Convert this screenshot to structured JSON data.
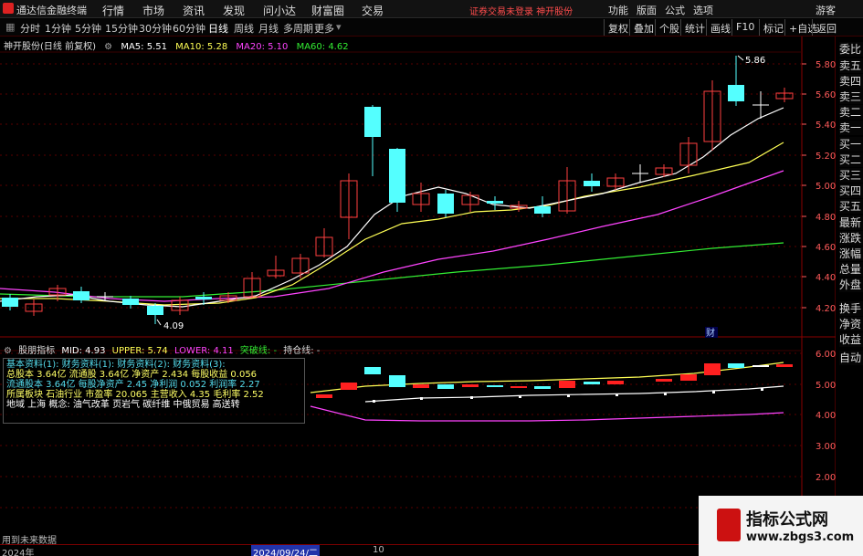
{
  "app": {
    "title": "通达信金融终端",
    "menu": [
      "行情",
      "市场",
      "资讯",
      "发现",
      "问小达",
      "财富圈",
      "交易"
    ],
    "notice": "证券交易未登录   神开股份",
    "right_menu": [
      "功能",
      "版面",
      "公式",
      "选项"
    ],
    "guest": "游客"
  },
  "toolbar": {
    "periods": [
      "分时",
      "1分钟",
      "5分钟",
      "15分钟",
      "30分钟",
      "60分钟",
      "日线",
      "周线",
      "月线",
      "多周期",
      "更多"
    ],
    "active_period": "日线",
    "right_buttons": [
      "复权",
      "叠加",
      "个股",
      "统计",
      "画线",
      "F10",
      "标记",
      "+自选",
      "返回"
    ]
  },
  "chart": {
    "stock_title": "神开股份(日线 前复权)",
    "ma": [
      {
        "label": "MA5: 5.51",
        "color": "#ffffff"
      },
      {
        "label": "MA10: 5.28",
        "color": "#ffff55"
      },
      {
        "label": "MA20: 5.10",
        "color": "#ff44ff"
      },
      {
        "label": "MA60: 4.62",
        "color": "#33ee33"
      }
    ],
    "high_label": "5.86",
    "low_label": "4.09",
    "cai_label": "财",
    "price_axis": [
      "5.80",
      "5.60",
      "5.40",
      "5.20",
      "5.00",
      "4.80",
      "4.60",
      "4.40",
      "4.20"
    ],
    "sub_axis": [
      "6.00",
      "5.00",
      "4.00",
      "3.00",
      "2.00"
    ],
    "sub_indicator": {
      "name": "股朋指标",
      "mid": "MID: 4.93",
      "upper": "UPPER: 5.74",
      "lower": "LOWER: 4.11",
      "breakout": "突破线: -",
      "position": "持仓线: -"
    },
    "info_box_rows": [
      "基本资料(1):   财务资料(1):   财务资料(2):   财务资料(3):",
      "总股本 3.64亿   流通股 3.64亿   净资产 2.434   每股收益 0.056",
      "流通股本 3.64亿  每股净资产 2.45   净利润 0.052   利润率 2.27",
      "所属板块 石油行业  市盈率 20.065   主营收入 4.35   毛利率 2.52",
      "地域 上海  概念: 油气改革 页岩气 碳纤维 中俄贸易 高送转"
    ],
    "future_note": "用到未来数据"
  },
  "date_axis": {
    "left": "2024年",
    "current": "2024/09/24/二",
    "mid": "10"
  },
  "sidebar": [
    "委比",
    "卖五",
    "卖四",
    "卖三",
    "卖二",
    "卖一",
    "买一",
    "买二",
    "买三",
    "买四",
    "买五",
    "最新",
    "涨跌",
    "涨幅",
    "总量",
    "外盘",
    "换手",
    "净资",
    "收益",
    "自动"
  ],
  "watermark": {
    "title": "指标公式网",
    "url": "www.zbgs3.com"
  }
}
